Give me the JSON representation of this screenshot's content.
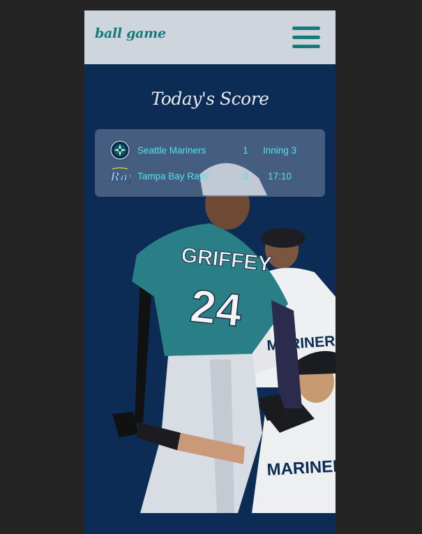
{
  "header": {
    "brand": "ball game",
    "menu_icon": "hamburger-menu-icon"
  },
  "main": {
    "title": "Today's Score",
    "hero_image": "mariners-players-photo",
    "hero_jersey_text": "GRIFFEY",
    "hero_jersey_number": "24",
    "hero_secondary_jersey_text": "MARINERS"
  },
  "scoreboard": {
    "games": [
      {
        "home": {
          "team": "Seattle Mariners",
          "logo": "mariners-logo-icon",
          "score": "1"
        },
        "away": {
          "team": "Tampa Bay Rays",
          "logo": "rays-logo-icon",
          "score": "0"
        },
        "inning": "Inning 3",
        "time": "17:10"
      }
    ]
  },
  "colors": {
    "page_bg": "#242424",
    "app_bg": "#0c2c56",
    "header_bg": "#cfd5dc",
    "brand_teal": "#157a7a",
    "score_text": "#50e3e8"
  }
}
